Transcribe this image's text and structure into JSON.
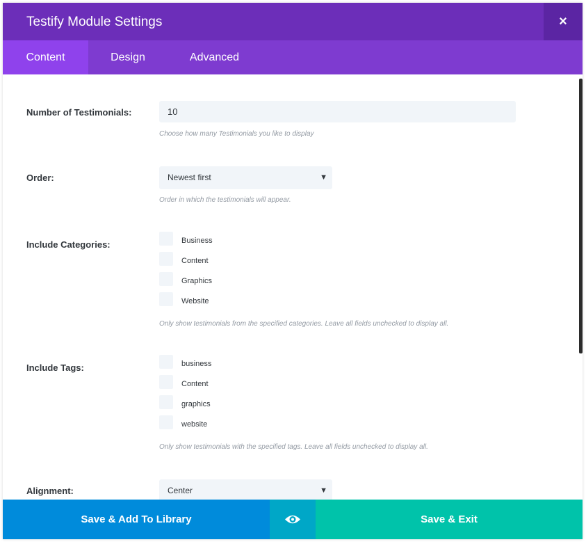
{
  "header": {
    "title": "Testify Module Settings",
    "close_label": "×"
  },
  "tabs": [
    {
      "label": "Content",
      "active": true
    },
    {
      "label": "Design",
      "active": false
    },
    {
      "label": "Advanced",
      "active": false
    }
  ],
  "fields": {
    "number_of_testimonials": {
      "label": "Number of Testimonials:",
      "value": "10",
      "description": "Choose how many Testimonials you like to display"
    },
    "order": {
      "label": "Order:",
      "value": "Newest first",
      "description": "Order in which the testimonials will appear."
    },
    "include_categories": {
      "label": "Include Categories:",
      "options": [
        {
          "label": "Business",
          "checked": false
        },
        {
          "label": "Content",
          "checked": false
        },
        {
          "label": "Graphics",
          "checked": false
        },
        {
          "label": "Website",
          "checked": false
        }
      ],
      "description": "Only show testimonials from the specified categories. Leave all fields unchecked to display all."
    },
    "include_tags": {
      "label": "Include Tags:",
      "options": [
        {
          "label": "business",
          "checked": false
        },
        {
          "label": "Content",
          "checked": false
        },
        {
          "label": "graphics",
          "checked": false
        },
        {
          "label": "website",
          "checked": false
        }
      ],
      "description": "Only show testimonials with the specified tags. Leave all fields unchecked to display all."
    },
    "alignment": {
      "label": "Alignment:",
      "value": "Center"
    }
  },
  "footer": {
    "save_library_label": "Save & Add To Library",
    "save_exit_label": "Save & Exit"
  },
  "icons": {
    "close": "close-icon",
    "preview": "eye-icon",
    "dropdown": "caret-down-icon"
  },
  "colors": {
    "header_bg": "#6c2eb9",
    "tabs_bg": "#7e3bd0",
    "active_tab_bg": "#8f42ec",
    "save_library_bg": "#008bdb",
    "preview_bg": "#00a7c7",
    "save_exit_bg": "#00c3aa"
  }
}
